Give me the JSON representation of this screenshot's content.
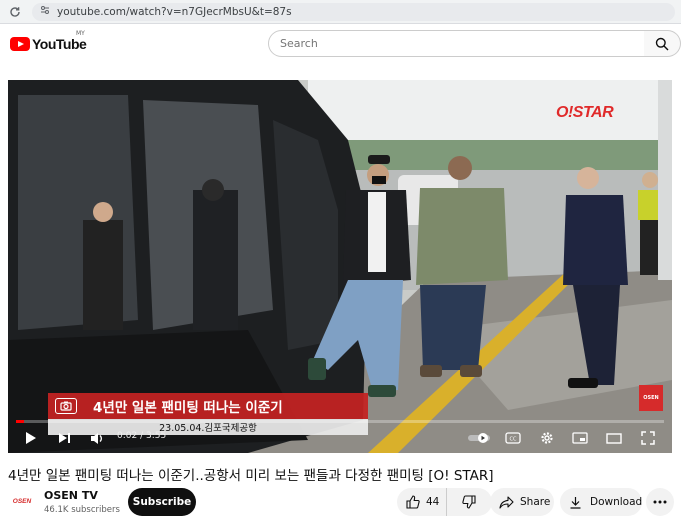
{
  "browser": {
    "url": "youtube.com/watch?v=n7GJecrMbsU&t=87s"
  },
  "header": {
    "logo_text": "YouTube",
    "region": "MY",
    "search_placeholder": "Search"
  },
  "player": {
    "watermark": "O!STAR",
    "corner_logo": "OSEN",
    "caption": "4년만 일본 팬미팅 떠나는 이준기",
    "date_location": "23.05.04.김포국제공항",
    "current_time": "0:02",
    "duration": "3:55",
    "time_display": "0:02 / 3:55",
    "progress_fraction": 0.013
  },
  "video": {
    "title": "4년만 일본 팬미팅 떠나는 이준기..공항서 미리 보는 팬들과 다정한 팬미팅 [O! STAR]"
  },
  "channel": {
    "avatar_text": "OSEN",
    "name": "OSEN TV",
    "subscribers": "46.1K subscribers",
    "subscribe_label": "Subscribe"
  },
  "actions": {
    "like_count": "44",
    "share_label": "Share",
    "download_label": "Download"
  },
  "colors": {
    "brand_red": "#ff0000",
    "caption_red": "#c42222",
    "progress_red": "#ff0000"
  }
}
